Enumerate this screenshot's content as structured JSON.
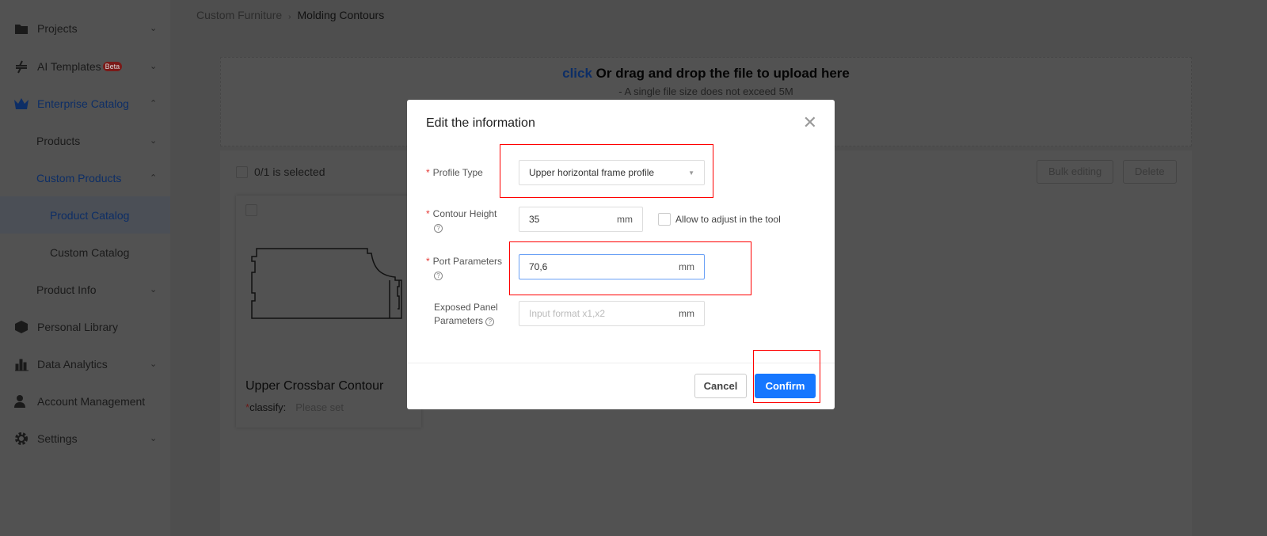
{
  "sidebar": {
    "items": [
      {
        "label": "Projects",
        "icon": "folder-icon"
      },
      {
        "label": "AI Templates",
        "badge": "Beta",
        "icon": "ai-icon"
      },
      {
        "label": "Enterprise Catalog",
        "icon": "crown-icon"
      },
      {
        "label": "Products"
      },
      {
        "label": "Custom Products"
      },
      {
        "label": "Product Catalog"
      },
      {
        "label": "Custom Catalog"
      },
      {
        "label": "Product Info"
      },
      {
        "label": "Personal Library",
        "icon": "cube-icon"
      },
      {
        "label": "Data Analytics",
        "icon": "chart-icon"
      },
      {
        "label": "Account Management",
        "icon": "users-icon"
      },
      {
        "label": "Settings",
        "icon": "gear-icon"
      }
    ]
  },
  "breadcrumb": {
    "parent": "Custom Furniture",
    "current": "Molding Contours"
  },
  "upload": {
    "link": "click",
    "text": " Or drag and drop the file to upload here",
    "hint": "- A single file size does not exceed 5M"
  },
  "panel": {
    "selected": "0/1 is selected",
    "bulk_edit": "Bulk editing",
    "delete": "Delete"
  },
  "card": {
    "name": "Upper Crossbar Contour",
    "classify_label": "classify:",
    "classify_placeholder": "Please set"
  },
  "modal": {
    "title": "Edit the information",
    "profile_type": {
      "label": "Profile Type",
      "value": "Upper horizontal frame profile"
    },
    "contour_height": {
      "label": "Contour Height",
      "value": "35",
      "unit": "mm",
      "allow_label": "Allow to adjust in the tool"
    },
    "port_parameters": {
      "label": "Port Parameters",
      "value": "70,6",
      "unit": "mm"
    },
    "exposed_panel": {
      "label_line1": "Exposed Panel",
      "label_line2": "Parameters",
      "placeholder": "Input format x1,x2",
      "unit": "mm"
    },
    "cancel": "Cancel",
    "confirm": "Confirm"
  },
  "colors": {
    "accent": "#1677ff",
    "highlight": "#ff0000"
  }
}
